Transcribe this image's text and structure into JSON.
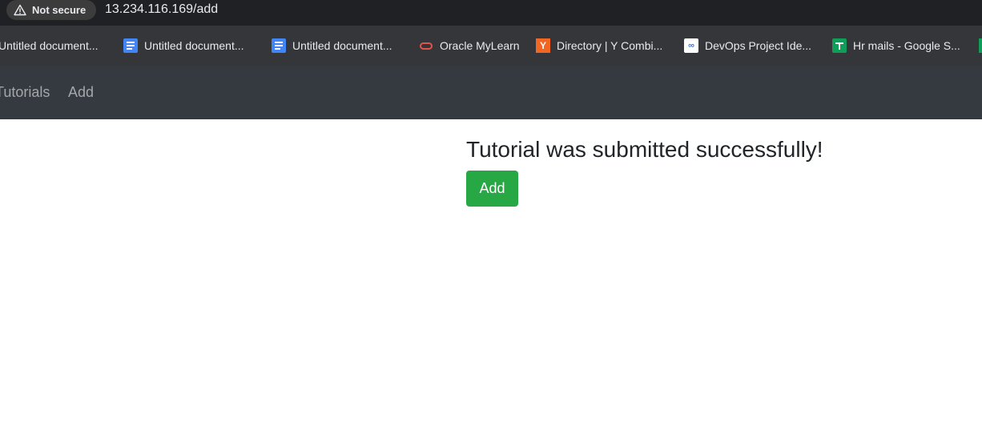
{
  "browser": {
    "security_label": "Not secure",
    "url": "13.234.116.169/add"
  },
  "bookmarks": [
    {
      "label": "Untitled document...",
      "icon": "google-docs-icon"
    },
    {
      "label": "Untitled document...",
      "icon": "google-docs-icon"
    },
    {
      "label": "Untitled document...",
      "icon": "google-docs-icon"
    },
    {
      "label": "Oracle MyLearn",
      "icon": "oracle-icon"
    },
    {
      "label": "Directory | Y Combi...",
      "icon": "ycombinator-icon"
    },
    {
      "label": "DevOps Project Ide...",
      "icon": "devops-icon"
    },
    {
      "label": "Hr mails - Google S...",
      "icon": "google-sheets-icon"
    }
  ],
  "navbar": {
    "links": [
      "Tutorials",
      "Add"
    ]
  },
  "content": {
    "message": "Tutorial was submitted successfully!",
    "add_button_label": "Add"
  },
  "colors": {
    "navbar_bg": "#343a40",
    "success_button": "#28a745",
    "browser_chrome": "#202124",
    "bookmarks_bar": "#35363a"
  }
}
